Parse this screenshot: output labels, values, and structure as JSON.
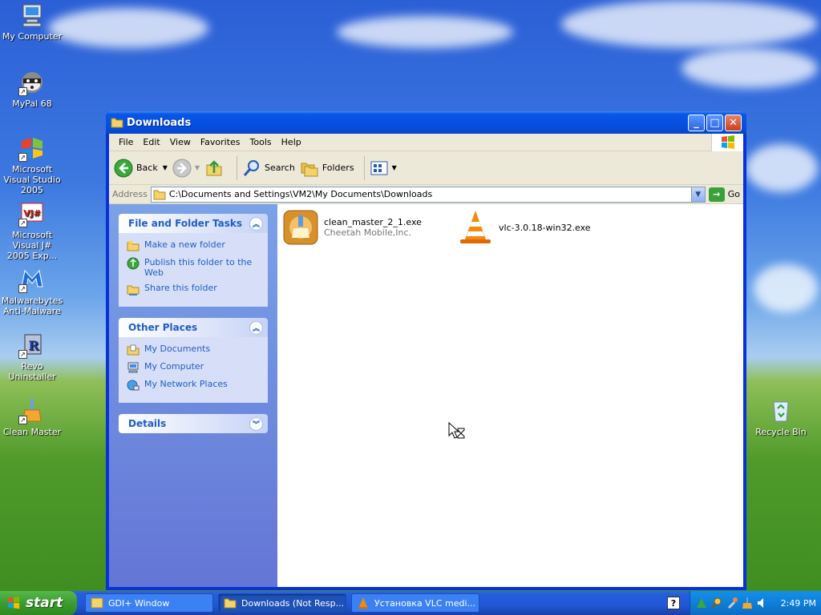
{
  "desktop": {
    "icons": [
      {
        "label": "My Computer"
      },
      {
        "label": "MyPal 68"
      },
      {
        "label": "Microsoft Visual Studio 2005"
      },
      {
        "label": "Microsoft Visual J# 2005 Exp..."
      },
      {
        "label": "Malwarebytes Anti-Malware"
      },
      {
        "label": "Revo Uninstaller"
      },
      {
        "label": "Clean Master"
      },
      {
        "label": "Recycle Bin"
      }
    ]
  },
  "window": {
    "title": "Downloads",
    "menu": [
      "File",
      "Edit",
      "View",
      "Favorites",
      "Tools",
      "Help"
    ],
    "toolbar": {
      "back": "Back",
      "search": "Search",
      "folders": "Folders"
    },
    "address": {
      "label": "Address",
      "value": "C:\\Documents and Settings\\VM2\\My Documents\\Downloads",
      "go": "Go"
    },
    "task_pane": {
      "file_tasks": {
        "title": "File and Folder Tasks",
        "items": [
          "Make a new folder",
          "Publish this folder to the Web",
          "Share this folder"
        ]
      },
      "other_places": {
        "title": "Other Places",
        "items": [
          "My Documents",
          "My Computer",
          "My Network Places"
        ]
      },
      "details": {
        "title": "Details"
      }
    },
    "files": [
      {
        "name": "clean_master_2_1.exe",
        "sub": "Cheetah Mobile,Inc."
      },
      {
        "name": "vlc-3.0.18-win32.exe",
        "sub": ""
      }
    ]
  },
  "taskbar": {
    "start": "start",
    "tasks": [
      {
        "label": "GDI+ Window"
      },
      {
        "label": "Downloads (Not Resp..."
      },
      {
        "label": "Установка VLC medi..."
      }
    ],
    "clock": "2:49 PM"
  },
  "colors": {
    "xp_blue": "#0831d9",
    "task_link": "#215dc6",
    "start_green": "#3c9c30"
  }
}
